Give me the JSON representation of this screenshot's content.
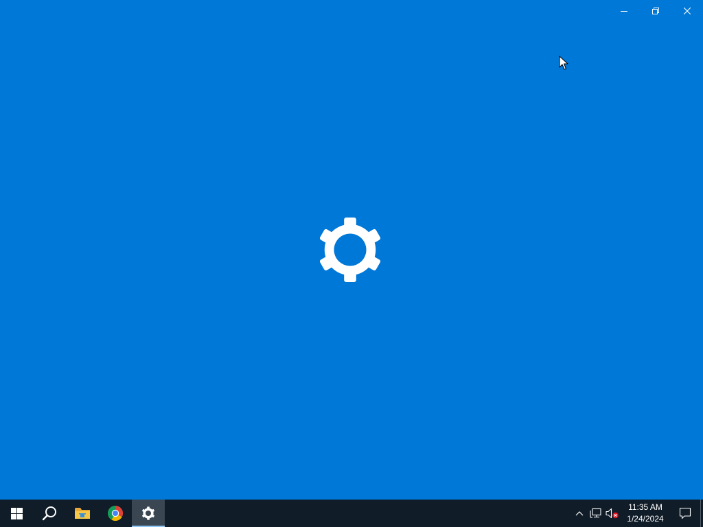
{
  "window": {
    "app": "Settings",
    "caption_buttons": [
      {
        "name": "minimize",
        "icon": "minimize-icon"
      },
      {
        "name": "restore",
        "icon": "restore-icon"
      },
      {
        "name": "close",
        "icon": "close-icon"
      }
    ],
    "splash_icon": "gear-icon"
  },
  "colors": {
    "accent": "#0078d7",
    "taskbar": "#101c28",
    "taskbar_active": "#3a4652",
    "active_indicator": "#8ec7f5",
    "text": "#ffffff"
  },
  "taskbar": {
    "items": [
      {
        "name": "start",
        "icon": "windows-logo-icon"
      },
      {
        "name": "search",
        "icon": "search-icon"
      },
      {
        "name": "file-explorer",
        "icon": "folder-icon"
      },
      {
        "name": "chrome",
        "icon": "chrome-icon"
      },
      {
        "name": "settings",
        "icon": "gear-icon",
        "active": true
      }
    ],
    "tray": {
      "icons": [
        "chevron-up-icon",
        "network-icon",
        "volume-muted-icon"
      ],
      "time": "11:35 AM",
      "date": "1/24/2024",
      "action_center_icon": "notification-icon"
    }
  }
}
